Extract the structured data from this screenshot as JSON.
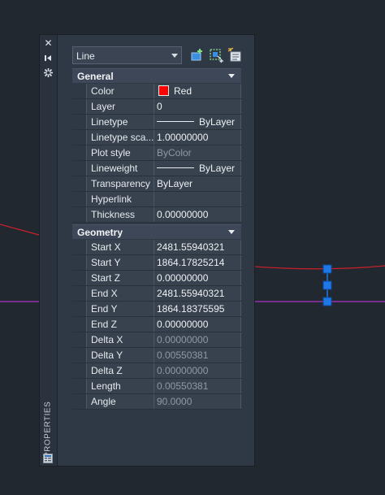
{
  "palette": {
    "title": "PROPERTIES",
    "selector": {
      "value": "Line"
    },
    "icons": [
      "close-icon",
      "autohide-icon",
      "palette-settings-icon",
      "toggle-pickadd-icon",
      "select-objects-icon",
      "quick-select-icon",
      "properties-palette-icon"
    ]
  },
  "general": {
    "title": "General",
    "rows": [
      {
        "label": "Color",
        "value": "Red",
        "readonly": false,
        "decor": "swatch"
      },
      {
        "label": "Layer",
        "value": "0",
        "readonly": false
      },
      {
        "label": "Linetype",
        "value": "ByLayer",
        "readonly": false,
        "decor": "line"
      },
      {
        "label": "Linetype sca...",
        "value": "1.00000000",
        "readonly": false
      },
      {
        "label": "Plot style",
        "value": "ByColor",
        "readonly": true
      },
      {
        "label": "Lineweight",
        "value": "ByLayer",
        "readonly": false,
        "decor": "line"
      },
      {
        "label": "Transparency",
        "value": "ByLayer",
        "readonly": false
      },
      {
        "label": "Hyperlink",
        "value": "",
        "readonly": false
      },
      {
        "label": "Thickness",
        "value": "0.00000000",
        "readonly": false
      }
    ]
  },
  "geometry": {
    "title": "Geometry",
    "rows": [
      {
        "label": "Start X",
        "value": "2481.55940321",
        "readonly": false
      },
      {
        "label": "Start Y",
        "value": "1864.17825214",
        "readonly": false
      },
      {
        "label": "Start Z",
        "value": "0.00000000",
        "readonly": false
      },
      {
        "label": "End X",
        "value": "2481.55940321",
        "readonly": false
      },
      {
        "label": "End Y",
        "value": "1864.18375595",
        "readonly": false
      },
      {
        "label": "End Z",
        "value": "0.00000000",
        "readonly": false
      },
      {
        "label": "Delta X",
        "value": "0.00000000",
        "readonly": true
      },
      {
        "label": "Delta Y",
        "value": "0.00550381",
        "readonly": true
      },
      {
        "label": "Delta Z",
        "value": "0.00000000",
        "readonly": true
      },
      {
        "label": "Length",
        "value": "0.00550381",
        "readonly": true
      },
      {
        "label": "Angle",
        "value": "90.0000",
        "readonly": true
      }
    ]
  },
  "colors": {
    "canvas": "#212830",
    "red_line": "#c8202a",
    "magenta_line": "#b030c8",
    "grip": "#1e78e6"
  }
}
